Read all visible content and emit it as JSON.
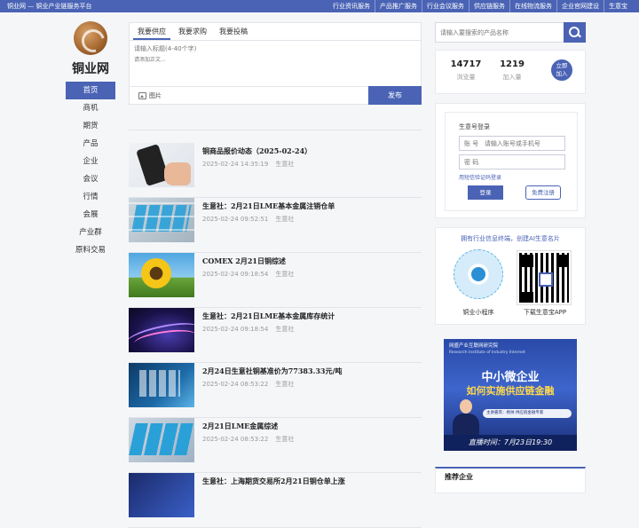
{
  "topbar": {
    "site": "铜业网 — 铜业产业链服务平台",
    "links": [
      "行业资讯服务",
      "产品推广服务",
      "行业会议服务",
      "供应链服务",
      "在线物流服务",
      "企业官网建设",
      "生意宝"
    ]
  },
  "brand": {
    "name": "铜业网"
  },
  "nav": {
    "items": [
      {
        "label": "首页",
        "active": true
      },
      {
        "label": "商机"
      },
      {
        "label": "期货"
      },
      {
        "label": "产品"
      },
      {
        "label": "企业"
      },
      {
        "label": "会议"
      },
      {
        "label": "行情"
      },
      {
        "label": "会展"
      },
      {
        "label": "产业群"
      },
      {
        "label": "原料交易"
      }
    ]
  },
  "post": {
    "tabs": [
      "我要供应",
      "我要求购",
      "我要投稿"
    ],
    "title_placeholder": "请输入标题(4-40个字)",
    "content_placeholder": "请添加正文...",
    "image_label": "图片",
    "publish_label": "发布"
  },
  "feed": [
    {
      "title": "铜商品报价动态（2025-02-24）",
      "time": "2025-02-24 14:35:19",
      "source": "生意社"
    },
    {
      "title": "生意社：2月21日LME基本金属注销仓单",
      "time": "2025-02-24 09:52:51",
      "source": "生意社"
    },
    {
      "title": "COMEX 2月21日铜综述",
      "time": "2025-02-24 09:18:54",
      "source": "生意社"
    },
    {
      "title": "生意社：2月21日LME基本金属库存统计",
      "time": "2025-02-24 09:18:54",
      "source": "生意社"
    },
    {
      "title": "2月24日生意社铜基准价为77383.33元/吨",
      "time": "2025-02-24 08:53:22",
      "source": "生意社"
    },
    {
      "title": "2月21日LME金属综述",
      "time": "2025-02-24 08:53:22",
      "source": "生意社"
    },
    {
      "title": "生意社：上海期货交易所2月21日铜仓单上涨",
      "time": "",
      "source": ""
    }
  ],
  "search": {
    "placeholder": "请输入要搜索的产品名称"
  },
  "stats": {
    "views": "14717",
    "views_label": "浏览量",
    "joins": "1219",
    "joins_label": "加入量",
    "join_btn": "立即\n加入"
  },
  "login": {
    "title": "生意号登录",
    "user_placeholder": "账 号   请输入账号或手机号",
    "pass_placeholder": "密 码",
    "sms": "用短信验证码登录",
    "login_btn": "登录",
    "register_btn": "免费注册"
  },
  "qr": {
    "title": "拥有行业信息终端，创建AI生意名片",
    "mini_label": "铜业小程序",
    "app_label": "下载生意宝APP"
  },
  "banner": {
    "org": "网盛产业互联网研究院",
    "org_en": "Research Institute of Industry Internet",
    "line1": "中小微企业",
    "line2": "如何实施供应链金融",
    "speaker": "主讲嘉宾：杨帅   供应链金融专家",
    "time": "直播时间：7月23日19:30"
  },
  "reco": {
    "title": "推荐企业"
  },
  "colors": {
    "accent": "#4a63b5"
  }
}
